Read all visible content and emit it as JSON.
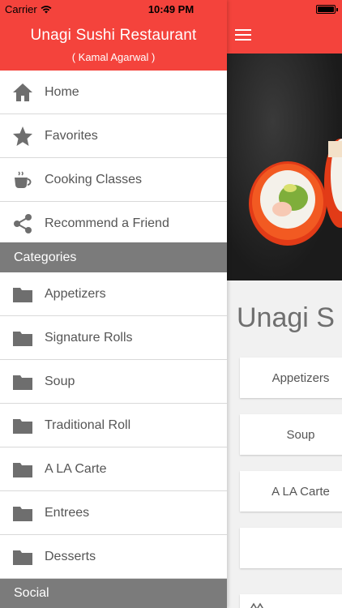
{
  "status_bar": {
    "carrier": "Carrier",
    "time": "10:49 PM",
    "icons": [
      "wifi-icon",
      "battery-icon"
    ]
  },
  "drawer": {
    "header": {
      "title": "Unagi Sushi Restaurant",
      "subtitle": "( Kamal Agarwal )"
    },
    "menu": [
      {
        "label": "Home",
        "icon": "home-icon"
      },
      {
        "label": "Favorites",
        "icon": "star-icon"
      },
      {
        "label": "Cooking Classes",
        "icon": "coffee-cup-icon"
      },
      {
        "label": "Recommend a Friend",
        "icon": "share-icon"
      }
    ],
    "categories_label": "Categories",
    "categories": [
      {
        "label": "Appetizers",
        "icon": "folder-icon"
      },
      {
        "label": "Signature Rolls",
        "icon": "folder-icon"
      },
      {
        "label": "Soup",
        "icon": "folder-icon"
      },
      {
        "label": "Traditional Roll",
        "icon": "folder-icon"
      },
      {
        "label": "A LA Carte",
        "icon": "folder-icon"
      },
      {
        "label": "Entrees",
        "icon": "folder-icon"
      },
      {
        "label": "Desserts",
        "icon": "folder-icon"
      }
    ],
    "social_label": "Social"
  },
  "main": {
    "menu_icon": "hamburger-menu-icon",
    "hero_image": "sushi-roll-image",
    "title": "Unagi S",
    "cards": [
      "Appetizers",
      "Soup",
      "A LA Carte",
      ""
    ]
  },
  "colors": {
    "accent": "#f4433c",
    "section_bg": "#7b7b7b",
    "icon": "#6e6e6e"
  }
}
